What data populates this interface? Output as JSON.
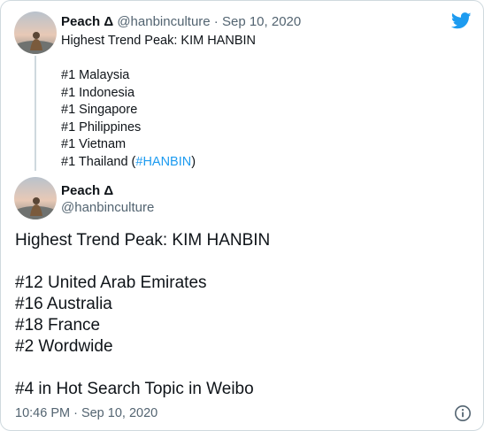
{
  "quoted_tweet": {
    "name": "Peach Δ",
    "handle": "@hanbinculture",
    "separator": "·",
    "date": "Sep 10, 2020",
    "lines": [
      "Highest Trend Peak: KIM HANBIN",
      "",
      "#1 Malaysia",
      "#1 Indonesia",
      "#1 Singapore",
      "#1 Philippines",
      "#1 Vietnam"
    ],
    "last_line_prefix": "#1 Thailand (",
    "last_line_hashtag": "#HANBIN",
    "last_line_suffix": ")"
  },
  "main_tweet": {
    "name": "Peach Δ",
    "handle": "@hanbinculture",
    "lines": [
      "Highest Trend Peak: KIM HANBIN",
      "",
      "#12 United Arab Emirates",
      "#16 Australia",
      "#18 France",
      "#2 Wordwide",
      "",
      "#4 in Hot Search Topic in Weibo"
    ],
    "timestamp": "10:46 PM · Sep 10, 2020"
  },
  "colors": {
    "link": "#1d9bf0",
    "twitter_brand": "#1d9bf0",
    "muted_text": "#536471"
  },
  "icons": [
    "twitter-bird-icon",
    "info-icon"
  ]
}
